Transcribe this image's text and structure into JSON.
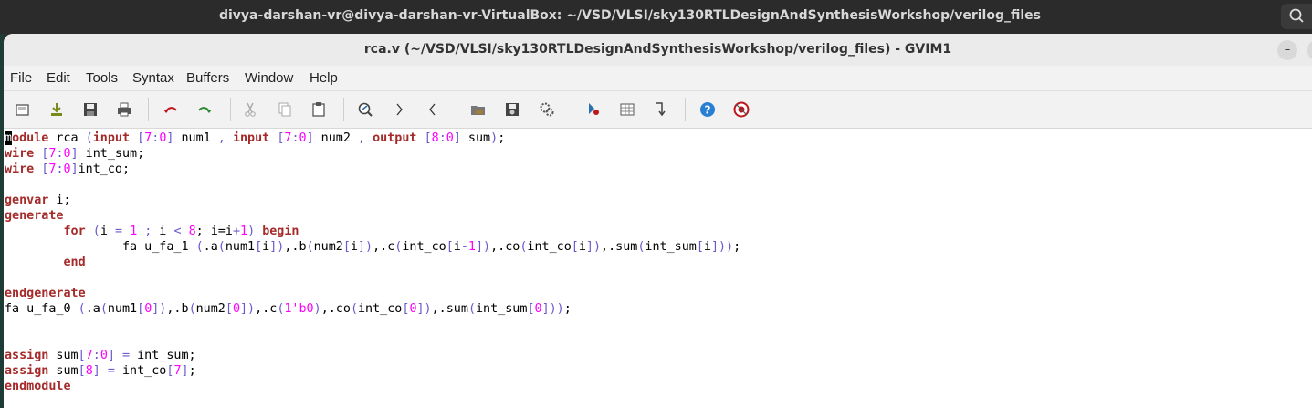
{
  "outer": {
    "title": "divya-darshan-vr@divya-darshan-vr-VirtualBox: ~/VSD/VLSI/sky130RTLDesignAndSynthesisWorkshop/verilog_files"
  },
  "window": {
    "title": "rca.v (~/VSD/VLSI/sky130RTLDesignAndSynthesisWorkshop/verilog_files) - GVIM1",
    "minimize_label": "–",
    "close_label": "✕"
  },
  "menu": [
    "File",
    "Edit",
    "Tools",
    "Syntax",
    "Buffers",
    "Window",
    "Help"
  ],
  "toolbar": {
    "icons": [
      "open-icon",
      "save-down-icon",
      "save-icon",
      "print-icon",
      "undo-icon",
      "redo-icon",
      "cut-icon",
      "copy-icon",
      "paste-icon",
      "find-replace-icon",
      "find-next-icon",
      "find-prev-icon",
      "load-session-icon",
      "save-session-icon",
      "run-script-icon",
      "make-icon",
      "ctags-icon",
      "jump-tag-icon",
      "help-icon",
      "find-help-icon"
    ]
  },
  "code": {
    "lines": [
      "module rca (input [7:0] num1 , input [7:0] num2 , output [8:0] sum);",
      "wire [7:0] int_sum;",
      "wire [7:0]int_co;",
      "",
      "genvar i;",
      "generate",
      "        for (i = 1 ; i < 8; i=i+1) begin",
      "                fa u_fa_1 (.a(num1[i]),.b(num2[i]),.c(int_co[i-1]),.co(int_co[i]),.sum(int_sum[i]));",
      "        end",
      "",
      "endgenerate",
      "fa u_fa_0 (.a(num1[0]),.b(num2[0]),.c(1'b0),.co(int_co[0]),.sum(int_sum[0]));",
      "",
      "",
      "assign sum[7:0] = int_sum;",
      "assign sum[8] = int_co[7];",
      "endmodule"
    ]
  },
  "colors": {
    "keyword": "#a52a2a",
    "type": "#2e8b57",
    "special": "#6a5acd",
    "number": "#ff00ff"
  }
}
